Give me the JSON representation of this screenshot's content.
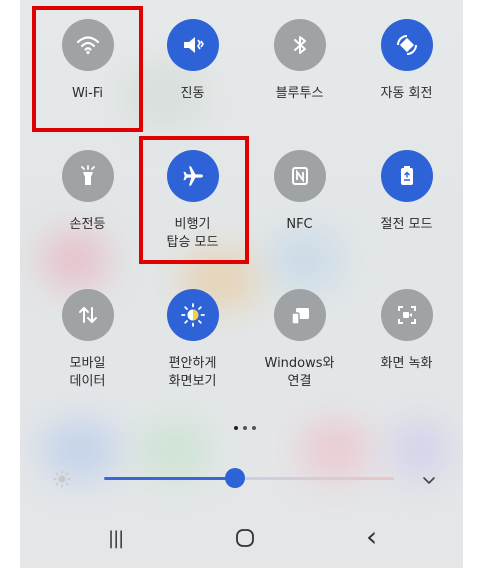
{
  "tiles": [
    {
      "label": "Wi-Fi",
      "icon": "wifi-icon",
      "state": "off"
    },
    {
      "label": "진동",
      "icon": "vibrate-icon",
      "state": "on"
    },
    {
      "label": "블루투스",
      "icon": "bluetooth-icon",
      "state": "off"
    },
    {
      "label": "자동 회전",
      "icon": "auto-rotate-icon",
      "state": "on"
    },
    {
      "label": "손전등",
      "icon": "flashlight-icon",
      "state": "off"
    },
    {
      "label": "비행기\n탑승 모드",
      "icon": "airplane-icon",
      "state": "on"
    },
    {
      "label": "NFC",
      "icon": "nfc-icon",
      "state": "off"
    },
    {
      "label": "절전 모드",
      "icon": "power-saving-icon",
      "state": "on"
    },
    {
      "label": "모바일\n데이터",
      "icon": "mobile-data-icon",
      "state": "off"
    },
    {
      "label": "편안하게\n화면보기",
      "icon": "eye-comfort-icon",
      "state": "on"
    },
    {
      "label": "Windows와\n연결",
      "icon": "link-to-windows-icon",
      "state": "off"
    },
    {
      "label": "화면 녹화",
      "icon": "screen-recorder-icon",
      "state": "off"
    }
  ],
  "pager": {
    "pages": 3,
    "current": 1
  },
  "brightness": {
    "level": 0.45
  },
  "navbar": {
    "recents_glyph": "|||",
    "back_glyph": "‹"
  },
  "colors": {
    "active": "#2e63d8",
    "inactive": "#9fa3a6",
    "highlight": "#e00000"
  }
}
